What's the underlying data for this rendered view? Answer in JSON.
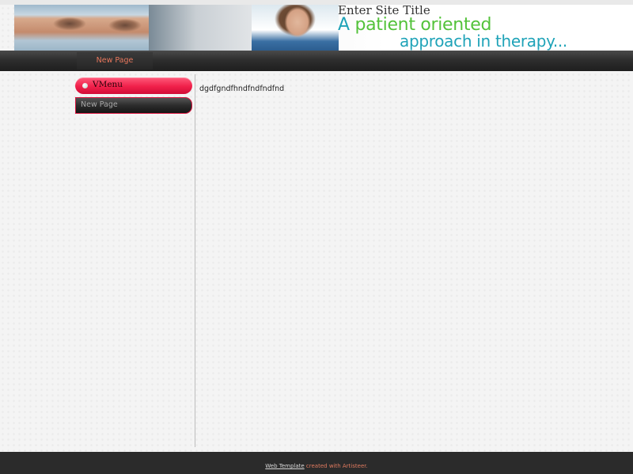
{
  "header": {
    "site_title": "Enter Site Title",
    "slogan_a": "A",
    "slogan_patient_oriented": "patient oriented",
    "slogan_line2": "approach in therapy..."
  },
  "nav": {
    "items": [
      {
        "label": "New Page"
      }
    ]
  },
  "sidebar": {
    "vmenu_title": "VMenu",
    "items": [
      {
        "label": "New Page"
      }
    ]
  },
  "content": {
    "text": "dgdfgndfhndfndfndfnd"
  },
  "footer": {
    "link_text": "Web Template",
    "suffix_text": " created with Artisteer."
  },
  "colors": {
    "accent_red": "#f0204a",
    "nav_text": "#e8775c",
    "teal": "#1fa3b8",
    "green": "#53c23a"
  }
}
